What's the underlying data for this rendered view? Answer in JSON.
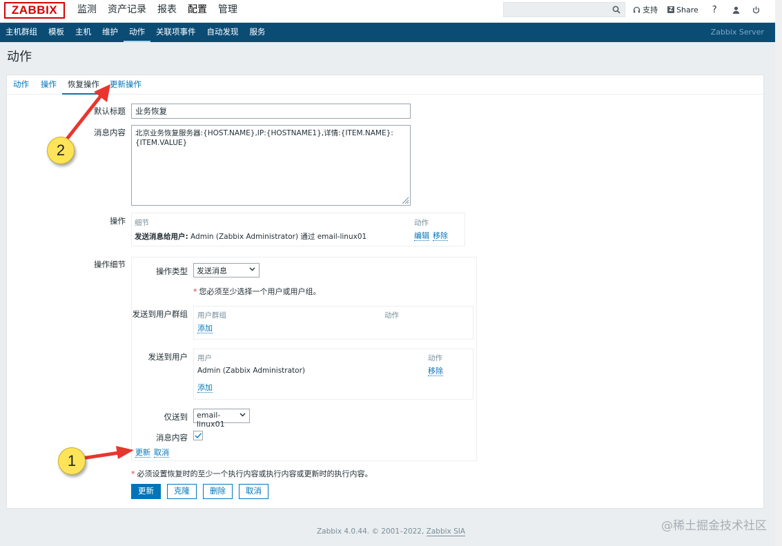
{
  "topbar": {
    "logo": "ZABBIX",
    "main_menu": [
      "监测",
      "资产记录",
      "报表",
      "配置",
      "管理"
    ],
    "search_placeholder": "",
    "support_label": "支持",
    "share_label": "Share",
    "help_label": "?"
  },
  "subnav": {
    "items": [
      "主机群组",
      "模板",
      "主机",
      "维护",
      "动作",
      "关联项事件",
      "自动发现",
      "服务"
    ],
    "server": "Zabbix Server"
  },
  "page": {
    "title": "动作"
  },
  "tabs": [
    "动作",
    "操作",
    "恢复操作",
    "更新操作"
  ],
  "form": {
    "subject_label": "默认标题",
    "subject_value": "业务恢复",
    "message_label": "消息内容",
    "message_value": "北京业务恢复服务器:{HOST.NAME},IP:{HOSTNAME1},详情:{ITEM.NAME}:{ITEM.VALUE}",
    "operations_label": "操作",
    "operations_col_detail": "细节",
    "operations_col_action": "动作",
    "operation_row_bold": "发送消息给用户:",
    "operation_row_text": "Admin (Zabbix Administrator) 通过 email-linux01",
    "edit_link": "编辑",
    "remove_link": "移除",
    "opdetails_label": "操作细节",
    "optype_label": "操作类型",
    "optype_value": "发送消息",
    "required_note": "您必须至少选择一个用户或用户组。",
    "send_groups_label": "发送到用户群组",
    "groups_col": "用户群组",
    "groups_action_col": "动作",
    "add_link": "添加",
    "send_users_label": "发送到用户",
    "users_col": "用户",
    "users_action_col": "动作",
    "user_row": "Admin (Zabbix Administrator)",
    "user_remove": "移除",
    "user_add": "添加",
    "sendonly_label": "仅送到",
    "sendonly_value": "email-linux01",
    "msgcontent_label": "消息内容",
    "inner_update": "更新",
    "inner_cancel": "取消",
    "bottom_note": "必须设置恢复时的至少一个执行内容或执行内容或更新时的执行内容。",
    "btn_update": "更新",
    "btn_clone": "克隆",
    "btn_delete": "删除",
    "btn_cancel": "取消"
  },
  "footer": {
    "text": "Zabbix 4.0.44. © 2001–2022, ",
    "company": "Zabbix SIA"
  },
  "watermark": "@稀土掘金技术社区",
  "annotations": {
    "marker1": "1",
    "marker2": "2",
    "arrow_color": "#e8352e"
  }
}
